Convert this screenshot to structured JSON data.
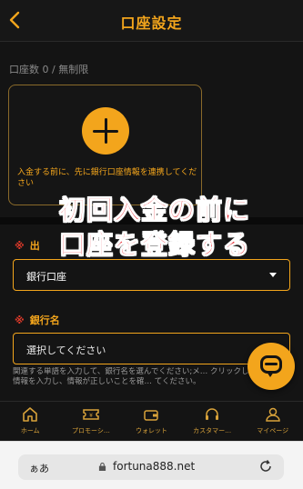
{
  "header": {
    "title": "口座設定",
    "back_icon": "chevron-left-icon"
  },
  "account_count": "口座数 0 / 無制限",
  "add_card": {
    "note": "入金する前に、先に銀行口座情報を連携してください",
    "icon": "plus-icon"
  },
  "overlay": {
    "line1": "初回入金の前に",
    "line2": "口座を登録する"
  },
  "form": {
    "field1_label": "出",
    "field1_value": "銀行口座",
    "field2_label": "銀行名",
    "field2_placeholder": "選択してください",
    "help": "関連する単語を入力して、銀行名を選んでください;メ… クリックして銀行名情報を入力し、情報が正しいことを確… てください。"
  },
  "nav": [
    {
      "label": "ホーム",
      "icon": "home-icon"
    },
    {
      "label": "プロモーシ…",
      "icon": "ticket-icon"
    },
    {
      "label": "ウォレット",
      "icon": "wallet-icon"
    },
    {
      "label": "カスタマー…",
      "icon": "headset-icon"
    },
    {
      "label": "マイページ",
      "icon": "user-icon"
    }
  ],
  "browser": {
    "aa": "ぁあ",
    "url": "fortuna888.net"
  },
  "colors": {
    "accent": "#f3a51c",
    "background": "#141414",
    "overlay_red": "#e8232b"
  }
}
